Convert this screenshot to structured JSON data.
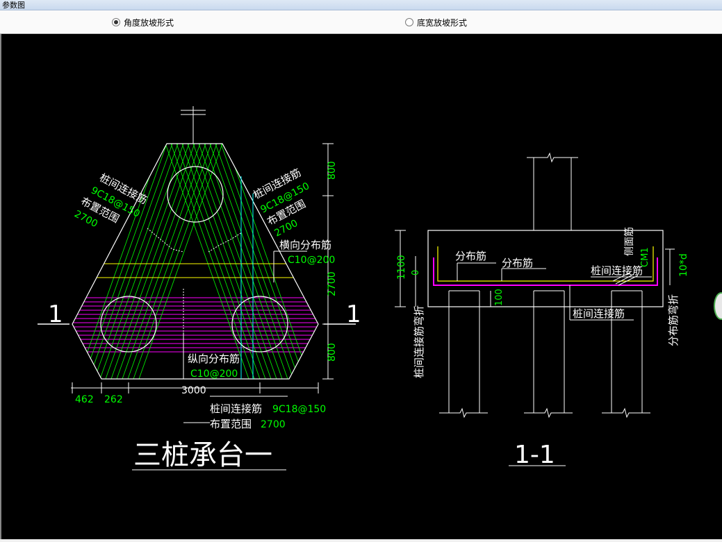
{
  "window": {
    "title": "参数图"
  },
  "options": [
    {
      "label": "角度放坡形式",
      "selected": true
    },
    {
      "label": "底宽放坡形式",
      "selected": false
    }
  ],
  "drawing": {
    "colors": {
      "bg": "#000000",
      "line": "#ffffff",
      "green": "#00ff00",
      "magenta": "#ff00ff",
      "yellow": "#ffff00",
      "cyan": "#00ffff"
    },
    "left": {
      "title": "三桩承台一",
      "section_mark": "1",
      "label_left_1": "桩间连接筋",
      "label_left_2": "9C18@150",
      "label_left_3": "布置范围",
      "label_left_4": "2700",
      "label_right_1": "桩间连接筋",
      "label_right_2": "9C18@150",
      "label_right_3": "布置范围",
      "label_right_4": "2700",
      "transverse_label": "横向分布筋",
      "transverse_value": "C10@200",
      "longitudinal_label": "纵向分布筋",
      "longitudinal_value": "C10@200",
      "bottom_label_1": "桩间连接筋",
      "bottom_value_1": "9C18@150",
      "bottom_label_2": "布置范围",
      "bottom_value_2": "2700",
      "dim_top": "800",
      "dim_mid": "2700",
      "dim_bot": "800",
      "dim_width": "3000",
      "dim_462": "462",
      "dim_262": "262"
    },
    "right": {
      "title": "1-1",
      "dim_height": "1100",
      "dim_zero": "0",
      "dim_100": "100",
      "label_dist1": "分布筋",
      "label_dist2": "分布筋",
      "label_side": "侧面筋",
      "label_side_val": "CM1",
      "label_pile1": "桩间连接筋",
      "label_pile2": "桩间连接筋",
      "label_10d": "10*d",
      "label_bend_left": "桩间连接筋弯折",
      "label_bend_right": "分布筋弯折"
    }
  }
}
